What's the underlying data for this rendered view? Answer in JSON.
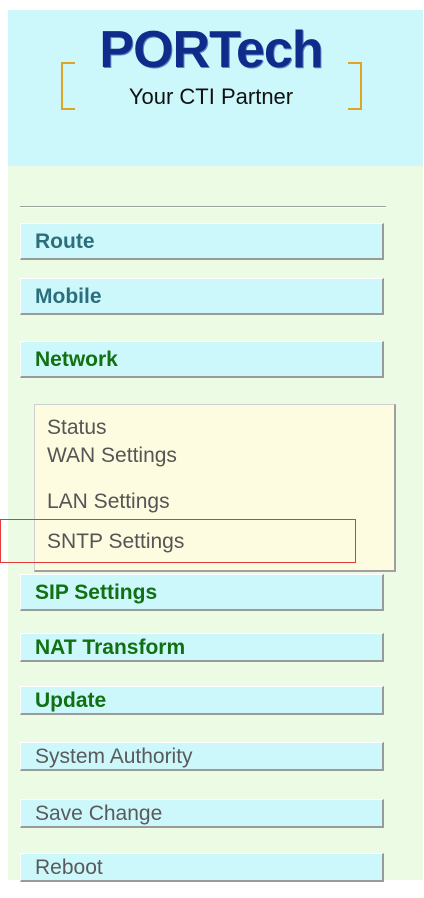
{
  "logo": {
    "title": "PORTech",
    "subtitle": "Your CTI Partner"
  },
  "menu": {
    "route": "Route",
    "mobile": "Mobile",
    "network": "Network",
    "network_submenu": [
      "Status",
      "WAN Settings",
      "LAN Settings",
      "SNTP Settings"
    ],
    "sip_settings": "SIP Settings",
    "nat_transform": "NAT Transform",
    "update": "Update",
    "system_authority": "System Authority",
    "save_change": "Save Change",
    "reboot": "Reboot"
  },
  "colors": {
    "panel_bg": "#ecfbe3",
    "button_bg": "#cdf8fb",
    "submenu_bg": "#fdfbe0",
    "highlight": "#e23a3a",
    "brand_blue": "#0f2c8a",
    "brand_orange": "#e0a424"
  }
}
